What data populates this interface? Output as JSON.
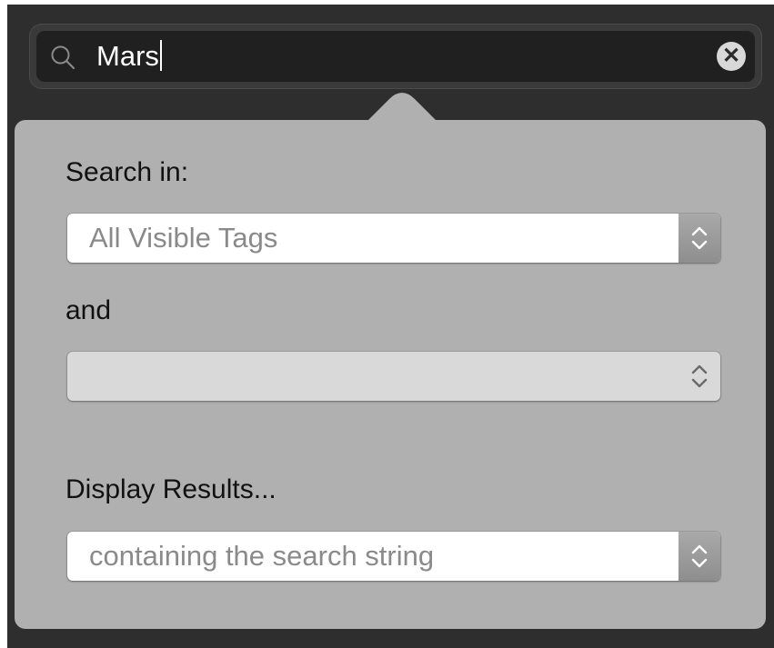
{
  "search": {
    "query": "Mars",
    "icon": "search-icon",
    "clear_icon": "clear-circle-icon",
    "clear_glyph": "✕"
  },
  "popover": {
    "search_in_label": "Search in:",
    "search_in_value": "All Visible Tags",
    "and_label": "and",
    "and_value": "",
    "display_results_label": "Display Results...",
    "display_results_value": "containing the search string"
  },
  "colors": {
    "window_bg": "#2e2e2e",
    "popover_bg": "#b0b0b0",
    "field_bg": "#202020",
    "select_active_bg": "#ffffff",
    "select_disabled_bg": "#d9d9d9",
    "placeholder_text": "#8a8a8a"
  }
}
